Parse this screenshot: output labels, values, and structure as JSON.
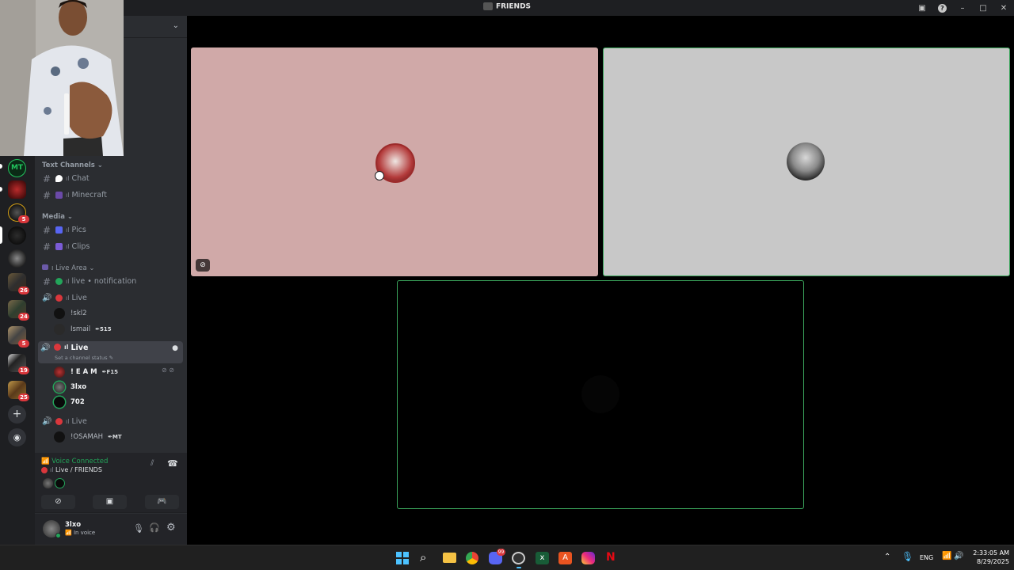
{
  "window": {
    "title": "FRIENDS"
  },
  "servers": [
    {
      "initials": "MT",
      "badge": ""
    },
    {
      "initials": "",
      "badge": ""
    },
    {
      "initials": "",
      "badge": "5"
    },
    {
      "initials": "",
      "badge": ""
    },
    {
      "initials": "",
      "badge": ""
    },
    {
      "initials": "",
      "badge": "26"
    },
    {
      "initials": "",
      "badge": "24"
    },
    {
      "initials": "",
      "badge": "5"
    },
    {
      "initials": "",
      "badge": "19"
    },
    {
      "initials": "",
      "badge": "25"
    }
  ],
  "sidebar": {
    "categories": {
      "text": "Text Channels",
      "media": "Media",
      "live_area": "Live Area"
    },
    "channels": {
      "chat": "Chat",
      "minecraft": "Minecraft",
      "pics": "Pics",
      "clips": "Clips",
      "live_notification": "live • notification",
      "live1": "Live",
      "live2": "Live",
      "live3": "Live"
    },
    "channel_status": "Set a channel status",
    "voice_users": {
      "live1": [
        {
          "name": "!skl2",
          "tag": ""
        },
        {
          "name": "Ismail",
          "tag": "515"
        }
      ],
      "live2": [
        {
          "name": "! E A M",
          "tag": "F15"
        },
        {
          "name": "3lxo",
          "tag": ""
        },
        {
          "name": "702",
          "tag": ""
        }
      ],
      "live3": [
        {
          "name": "!OSAMAH",
          "tag": "MT"
        }
      ]
    }
  },
  "voice": {
    "status": "Voice Connected",
    "channel": "Live / FRIENDS"
  },
  "user": {
    "name": "3lxo",
    "status": "In voice"
  },
  "taskbar": {
    "lang": "ENG",
    "time": "2:33:05 AM",
    "date": "8/29/2025",
    "discord_badge": "99"
  },
  "colors": {
    "voice_green": "#23a55a",
    "tile1_bg": "#d0a9a8",
    "tile2_bg": "#c8c8c8",
    "speaking_outline": "#3ba55c"
  }
}
